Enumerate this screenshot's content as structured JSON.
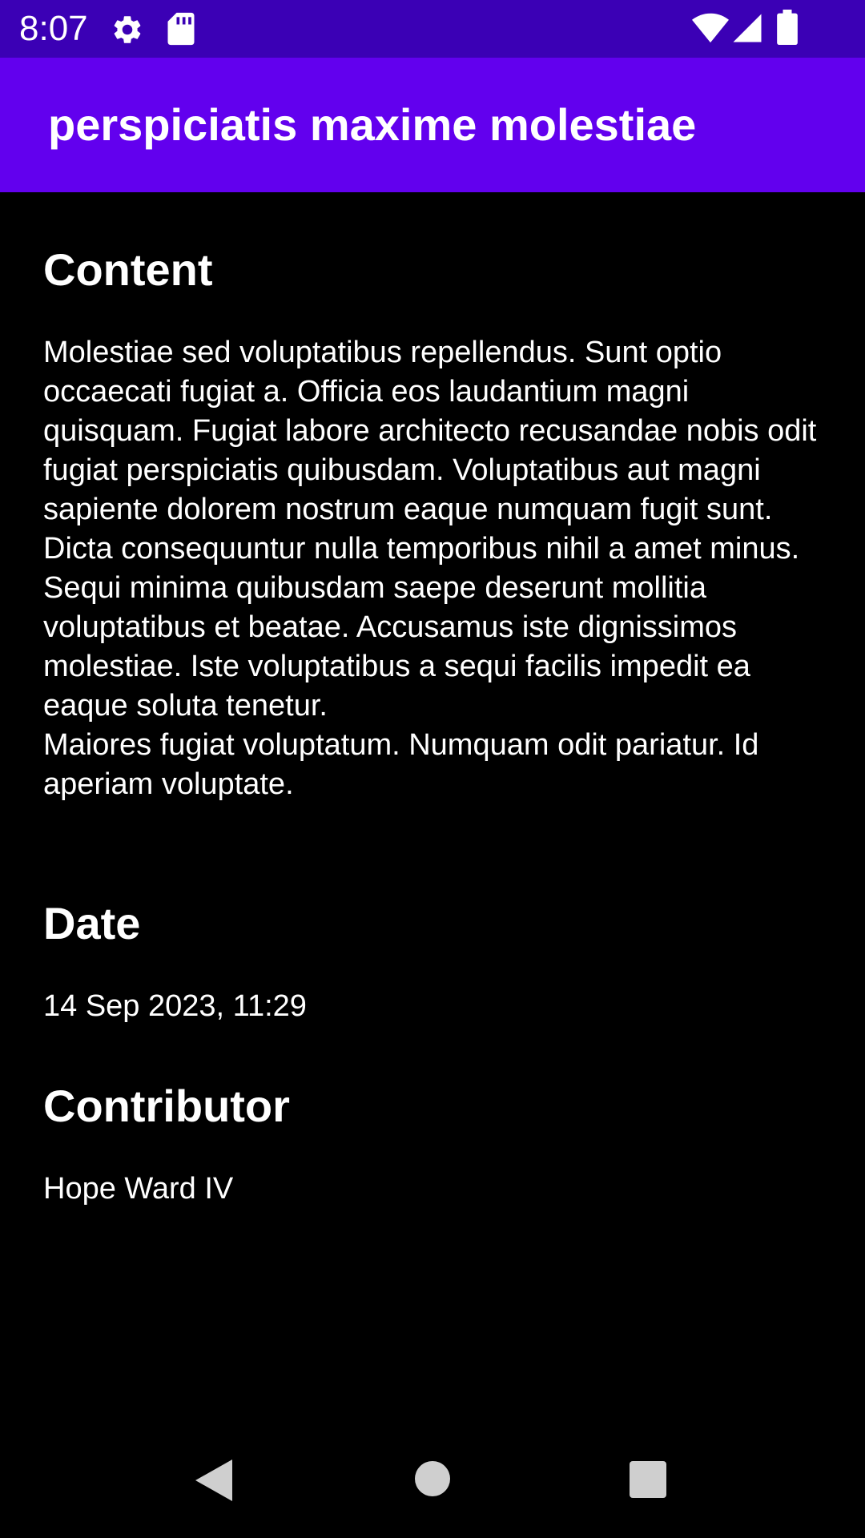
{
  "status_bar": {
    "time": "8:07",
    "icons_left": [
      "gear-icon",
      "sd-card-icon"
    ],
    "icons_right": [
      "wifi-icon",
      "signal-icon",
      "battery-icon"
    ],
    "background": "#3b00b5"
  },
  "app_bar": {
    "title": "perspiciatis maxime molestiae",
    "background": "#6200ee"
  },
  "sections": {
    "content": {
      "heading": "Content",
      "text": "Molestiae sed voluptatibus repellendus. Sunt optio occaecati fugiat a. Officia eos laudantium magni quisquam. Fugiat labore architecto recusandae nobis odit fugiat perspiciatis quibusdam. Voluptatibus aut magni sapiente dolorem nostrum eaque numquam fugit sunt.\nDicta consequuntur nulla temporibus nihil a amet minus. Sequi minima quibusdam saepe deserunt mollitia voluptatibus et beatae. Accusamus iste dignissimos molestiae. Iste voluptatibus a sequi facilis impedit ea eaque soluta tenetur.\nMaiores fugiat voluptatum. Numquam odit pariatur. Id aperiam voluptate."
    },
    "date": {
      "heading": "Date",
      "value": "14 Sep 2023, 11:29"
    },
    "contributor": {
      "heading": "Contributor",
      "value": "Hope Ward IV"
    }
  },
  "nav_bar": {
    "buttons": [
      "back-icon",
      "home-icon",
      "recents-icon"
    ]
  }
}
